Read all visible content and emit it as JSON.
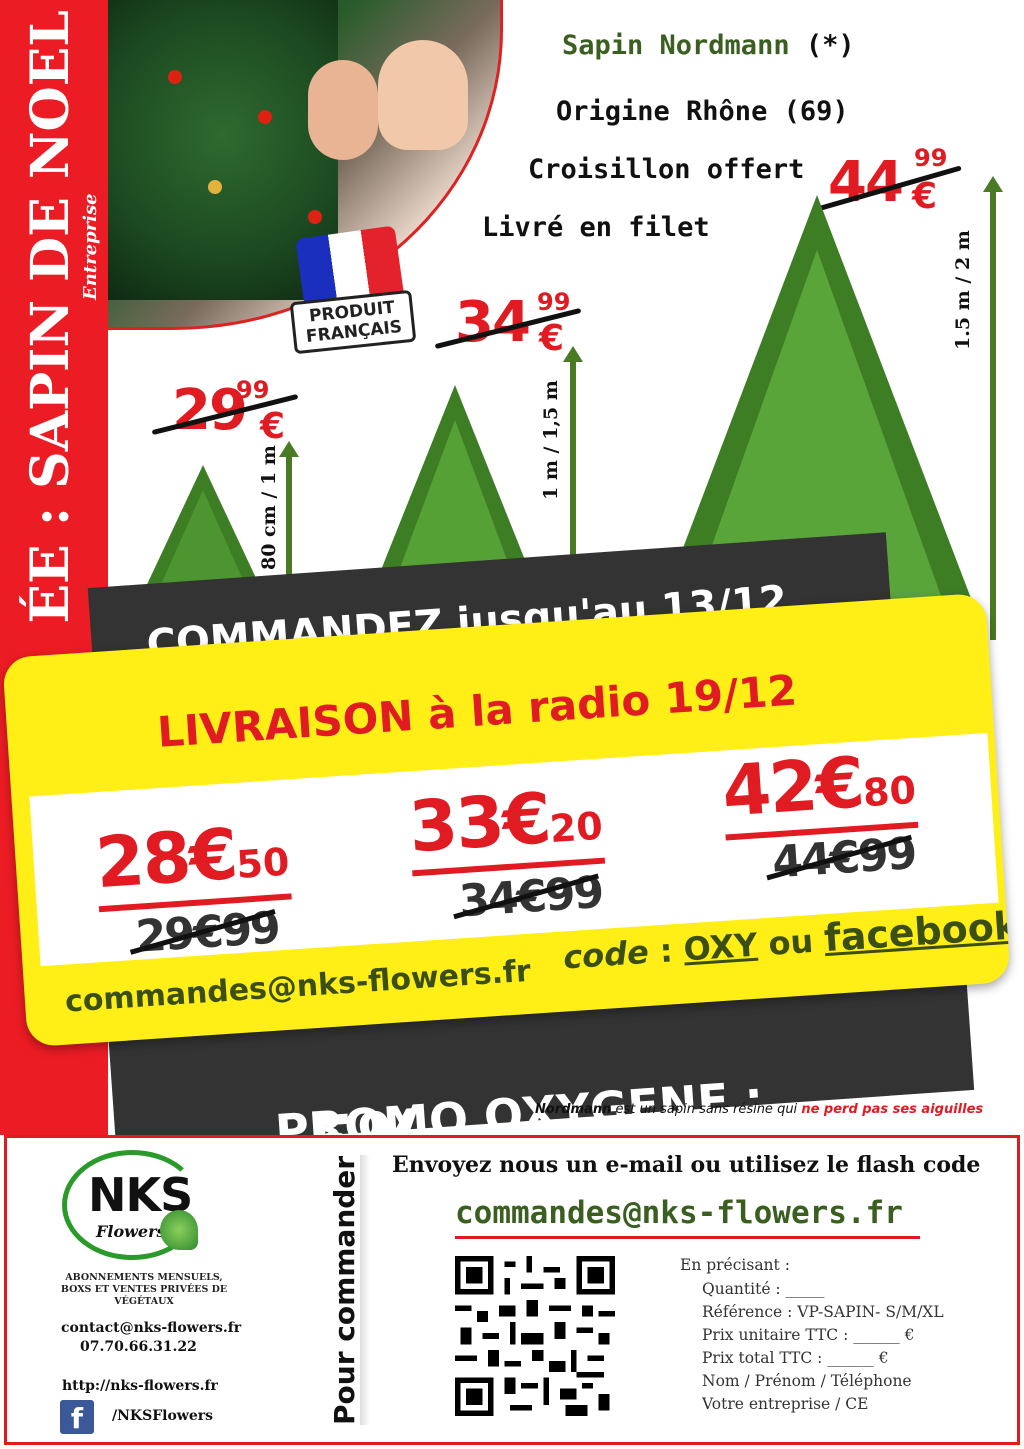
{
  "side": {
    "title": "ÉE : SAPIN DE NOEL",
    "subtitle": "Entreprise"
  },
  "badge": {
    "label": "PRODUIT FRANÇAIS"
  },
  "features": {
    "line1_name": "Sapin Nordmann",
    "line1_mark": "(*)",
    "line2": "Origine Rhône (69)",
    "line3": "Croisillon offert",
    "line4": "Livré en filet"
  },
  "trees": [
    {
      "old_int": "29",
      "old_cents": "99",
      "currency": "€",
      "height": "80 cm / 1 m",
      "size_fraction": 0.25
    },
    {
      "old_int": "34",
      "old_cents": "99",
      "currency": "€",
      "height": "1 m / 1,5 m",
      "size_fraction": 0.5
    },
    {
      "old_int": "44",
      "old_cents": "99",
      "currency": "€",
      "height": "1.5 m / 2 m",
      "size_fraction": 1.0
    }
  ],
  "banner_top": "COMMANDEZ jusqu'au 13/12",
  "card": {
    "delivery": "LIVRAISON à la radio 19/12",
    "prices": [
      {
        "new_int": "28€",
        "new_cents": "50",
        "old": "29€99"
      },
      {
        "new_int": "33€",
        "new_cents": "20",
        "old": "34€99"
      },
      {
        "new_int": "42€",
        "new_cents": "80",
        "old": "44€99"
      }
    ],
    "email": "commandes@nks-flowers.fr",
    "code_label": "code",
    "code_sep": ":",
    "code_value": "OXY",
    "code_or": "ou",
    "code_alt": "facebook"
  },
  "banner_bottom": {
    "label": "PROMO OXYGENE :",
    "percent": "-5%"
  },
  "note": {
    "prefix": "Nordmann",
    "text": "est un sapin sans résine qui",
    "highlight": "ne perd pas ses aiguilles"
  },
  "footer": {
    "logo_name": "NKS",
    "logo_sub": "Flowers",
    "tagline": "ABONNEMENTS MENSUELS, BOXS ET VENTES PRIVÉES DE VÉGÉTAUX",
    "contact_email": "contact@nks-flowers.fr",
    "phone": "07.70.66.31.22",
    "website": "http://nks-flowers.fr",
    "facebook": "/NKSFlowers",
    "side_label": "Pour commander",
    "instruction": "Envoyez nous un e-mail ou utilisez le flash code",
    "order_email": "commandes@nks-flowers.fr",
    "spec_title": "En précisant :",
    "spec_lines": [
      "Quantité :                _____",
      "Référence :   VP-SAPIN- S/M/XL",
      "Prix unitaire TTC :       ______ €",
      "Prix total TTC :          ______ €",
      "Nom / Prénom / Téléphone",
      "Votre entreprise / CE"
    ]
  },
  "colors": {
    "brand_red": "#ec1c24",
    "price_red": "#e01b22",
    "card_yellow": "#ffef17",
    "dark_band": "#333333",
    "leaf_green": "#3b5f20"
  }
}
